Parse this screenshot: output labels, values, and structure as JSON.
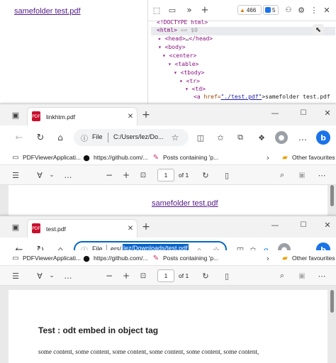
{
  "background_page": {
    "link_text": "samefolder test.pdf"
  },
  "devtools": {
    "warnings_count": "466",
    "info_count": "5",
    "dom_lines": {
      "doctype": "<!DOCTYPE html>",
      "html_open": "<html>",
      "html_eq": "== $0",
      "head": "<head>",
      "head_dots": "…",
      "head_close": "</head>",
      "body": "<body>",
      "center": "<center>",
      "table": "<table>",
      "tbody": "<tbody>",
      "tr": "<tr>",
      "td": "<td>",
      "a_open": "<a ",
      "a_attr": "href=",
      "a_val": "\"./test.pdf\"",
      "a_text": ">samefolder test.pdf"
    }
  },
  "window1": {
    "tab_title": "linkhtm.pdf",
    "address_prefix": "File",
    "address_text": "C:/Users/lez/Do...",
    "favorites": [
      {
        "icon": "folder-icon",
        "label": "PDFViewerApplicati..."
      },
      {
        "icon": "github-icon",
        "label": "https://github.com/..."
      },
      {
        "icon": "pen-icon",
        "label": "Posts containing 'p..."
      }
    ],
    "other_favorites": "Other favourites",
    "page_number": "1",
    "page_of": "of 1",
    "content_link": "samefolder test.pdf"
  },
  "window2": {
    "tab_title": "test.pdf",
    "address_prefix": "File",
    "address_text_plain": "ers/",
    "address_text_selected": "lez/Downloads/test.pdf",
    "favorites": [
      {
        "icon": "folder-icon",
        "label": "PDFViewerApplicati..."
      },
      {
        "icon": "github-icon",
        "label": "https://github.com/..."
      },
      {
        "icon": "pen-icon",
        "label": "Posts containing 'p..."
      }
    ],
    "other_favorites": "Other favourites",
    "page_number": "1",
    "page_of": "of 1",
    "pdf_heading": "Test : odt embed in object tag",
    "pdf_text": "some content, some content, some content, some content, some content, some content,"
  },
  "colors": {
    "accent": "#0067c0",
    "selection": "#0a64c8",
    "link": "#551a8b",
    "edge_blue": "#1a73e8"
  }
}
